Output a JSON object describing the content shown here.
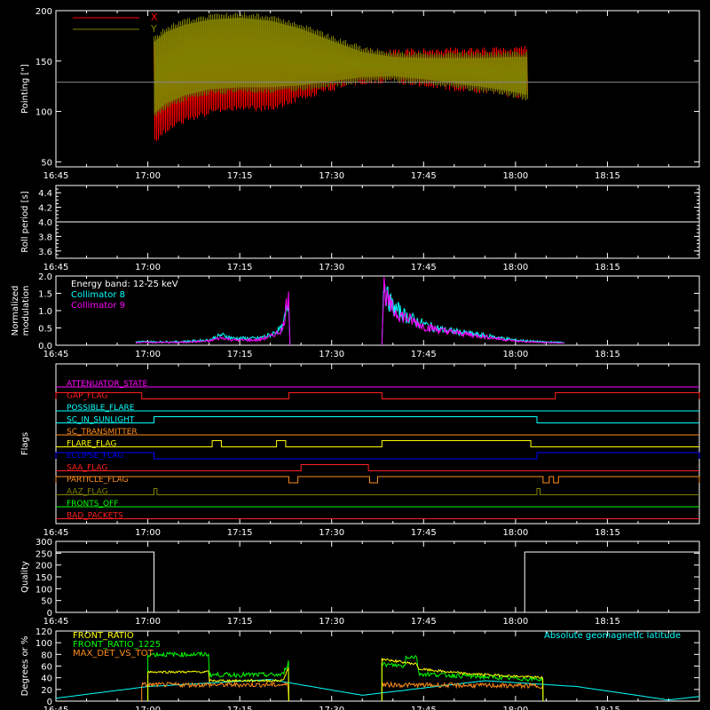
{
  "time_axis": {
    "tmin": "16:45",
    "tmax": "18:30",
    "tick_labels": [
      "16:45",
      "17:00",
      "17:15",
      "17:30",
      "17:45",
      "18:00",
      "18:15"
    ]
  },
  "colors": {
    "axes": "#ffffff",
    "x": "#ff0000",
    "y": "#808000",
    "cyan": "#00ffff",
    "magenta": "#ff00ff",
    "yellow": "#ffff00",
    "green": "#00ff00",
    "orange": "#ff8c1a",
    "red": "#ff2020",
    "blue": "#0000ff"
  },
  "chart_data": [
    {
      "type": "line",
      "id": "pointing",
      "ylabel": "Pointing [\"]",
      "ylim": [
        45,
        200
      ],
      "yticks": [
        "50",
        "100",
        "150",
        "200"
      ],
      "legend": [
        "X",
        "Y"
      ],
      "legend_position": "top-left",
      "reference_line": 129,
      "series": [
        {
          "name": "X",
          "x": [
            "17:01",
            "17:03",
            "17:06",
            "17:10",
            "17:15",
            "17:20",
            "17:25",
            "17:30",
            "17:35",
            "17:40",
            "17:45",
            "17:50",
            "17:55",
            "18:00",
            "18:02"
          ],
          "upper": [
            172,
            180,
            186,
            190,
            190,
            188,
            180,
            170,
            163,
            162,
            163,
            164,
            164,
            165,
            165
          ],
          "lower": [
            68,
            78,
            88,
            96,
            100,
            100,
            110,
            120,
            126,
            127,
            124,
            120,
            117,
            113,
            112
          ]
        },
        {
          "name": "Y",
          "x": [
            "17:01",
            "17:03",
            "17:06",
            "17:10",
            "17:15",
            "17:20",
            "17:25",
            "17:30",
            "17:35",
            "17:40",
            "17:45",
            "17:50",
            "17:55",
            "18:00",
            "18:02"
          ],
          "upper": [
            175,
            185,
            192,
            197,
            199,
            196,
            188,
            176,
            165,
            160,
            159,
            159,
            159,
            160,
            160
          ],
          "lower": [
            92,
            102,
            110,
            116,
            118,
            118,
            120,
            124,
            128,
            129,
            126,
            122,
            118,
            113,
            110
          ]
        }
      ]
    },
    {
      "type": "line",
      "id": "roll-period",
      "ylabel": "Roll period [s]",
      "ylim": [
        3.5,
        4.5
      ],
      "yticks": [
        "3.6",
        "3.8",
        "4.0",
        "4.2",
        "4.4"
      ],
      "series": [
        {
          "x": [
            "16:45",
            "18:30"
          ],
          "y": [
            4.0,
            4.0
          ]
        }
      ]
    },
    {
      "type": "line",
      "id": "modulation",
      "ylabel": "Normalized modulation",
      "ylim": [
        0,
        2.0
      ],
      "yticks": [
        "0.0",
        "0.5",
        "1.0",
        "1.5",
        "2.0"
      ],
      "annotation": "Energy band: 12-25 keV",
      "legend_position": "top-left",
      "series": [
        {
          "name": "Collimator 8",
          "x": [
            "16:58",
            "17:05",
            "17:10",
            "17:12",
            "17:14",
            "17:18",
            "17:20",
            "17:22",
            "17:23",
            "17:23.2",
            "17:38.2",
            "17:38.5",
            "17:39",
            "17:40",
            "17:42",
            "17:45",
            "17:48",
            "17:52",
            "17:56",
            "18:00",
            "18:04",
            "18:08"
          ],
          "y": [
            0.1,
            0.1,
            0.15,
            0.3,
            0.2,
            0.2,
            0.3,
            0.5,
            1.3,
            0.0,
            0.0,
            1.9,
            1.4,
            1.1,
            0.85,
            0.6,
            0.45,
            0.35,
            0.25,
            0.15,
            0.1,
            0.08
          ]
        },
        {
          "name": "Collimator 9",
          "x": [
            "16:58",
            "17:05",
            "17:10",
            "17:12",
            "17:14",
            "17:18",
            "17:20",
            "17:22",
            "17:23",
            "17:23.2",
            "17:38.2",
            "17:38.5",
            "17:39",
            "17:40",
            "17:42",
            "17:45",
            "17:48",
            "17:52",
            "17:56",
            "18:00",
            "18:04",
            "18:08"
          ],
          "y": [
            0.08,
            0.08,
            0.12,
            0.22,
            0.15,
            0.15,
            0.25,
            0.45,
            1.6,
            0.0,
            0.0,
            1.75,
            1.3,
            1.0,
            0.8,
            0.55,
            0.42,
            0.32,
            0.22,
            0.12,
            0.08,
            0.06
          ]
        }
      ]
    },
    {
      "type": "line",
      "id": "flags",
      "ylabel": "Flags",
      "series": [
        {
          "name": "ATTENUATOR_STATE",
          "color": "#ff00ff",
          "segments": []
        },
        {
          "name": "GAP_FLAG",
          "color": "#ff2020",
          "segments": [
            [
              "16:45",
              "16:59"
            ],
            [
              "17:23",
              "17:38.2"
            ],
            [
              "18:06.5",
              "18:30"
            ]
          ]
        },
        {
          "name": "POSSIBLE_FLARE",
          "color": "#00ffff",
          "segments": []
        },
        {
          "name": "SC_IN_SUNLIGHT",
          "color": "#00ffff",
          "segments": [
            [
              "17:01",
              "18:03.5"
            ]
          ]
        },
        {
          "name": "SC_TRANSMITTER",
          "color": "#ff8c1a",
          "segments": []
        },
        {
          "name": "FLARE_FLAG",
          "color": "#ffff00",
          "segments": [
            [
              "17:10.5",
              "17:12"
            ],
            [
              "17:21",
              "17:22.5"
            ],
            [
              "17:38.2",
              "18:02.5"
            ]
          ]
        },
        {
          "name": "ECLIPSE_FLAG",
          "color": "#0000ff",
          "segments": [
            [
              "16:45",
              "17:01"
            ],
            [
              "18:03.5",
              "18:30"
            ]
          ]
        },
        {
          "name": "SAA_FLAG",
          "color": "#ff2020",
          "segments": [
            [
              "17:25",
              "17:36"
            ]
          ]
        },
        {
          "name": "PARTICLE_FLAG",
          "color": "#ff8c1a",
          "segments": [
            [
              "16:45",
              "17:23"
            ],
            [
              "17:24.5",
              "17:36.2"
            ],
            [
              "17:37.5",
              "18:04.5"
            ],
            [
              "18:05.5",
              "18:06.2"
            ],
            [
              "18:07",
              "18:30"
            ]
          ]
        },
        {
          "name": "AAZ_FLAG",
          "color": "#808000",
          "segments": [
            [
              "17:01",
              "17:01.5"
            ],
            [
              "18:03.5",
              "18:04"
            ]
          ]
        },
        {
          "name": "FRONTS_OFF",
          "color": "#00ff00",
          "segments": []
        },
        {
          "name": "BAD_PACKETS",
          "color": "#ff2020",
          "segments": []
        }
      ]
    },
    {
      "type": "line",
      "id": "quality",
      "ylabel": "Quality",
      "ylim": [
        0,
        300
      ],
      "yticks": [
        "0",
        "50",
        "100",
        "150",
        "200",
        "250",
        "300"
      ],
      "series": [
        {
          "x": [
            "16:45",
            "17:01",
            "17:01",
            "18:01.5",
            "18:01.5",
            "18:30"
          ],
          "y": [
            255,
            255,
            0,
            0,
            255,
            255
          ]
        }
      ]
    },
    {
      "type": "line",
      "id": "ratios",
      "ylabel": "Degrees or %",
      "ylim": [
        0,
        120
      ],
      "yticks": [
        "0",
        "20",
        "40",
        "60",
        "80",
        "100",
        "120"
      ],
      "legend_position": "top-left",
      "annotation": "Absolute geomagnetic latitude",
      "series": [
        {
          "name": "FRONT_RATIO",
          "x": [
            "17:00",
            "17:00",
            "17:10",
            "17:10",
            "17:23",
            "17:23"
          ],
          "y": [
            0,
            50,
            50,
            35,
            35,
            0
          ]
        },
        {
          "name": "FRONT_RATIO_1225",
          "x": [
            "17:00",
            "17:00",
            "17:10",
            "17:10",
            "17:22",
            "17:23",
            "17:23"
          ],
          "y": [
            0,
            80,
            80,
            45,
            45,
            70,
            0
          ]
        },
        {
          "name": "MAX_DET_VS_TOT",
          "x": [
            "16:59",
            "16:59",
            "17:23",
            "17:23"
          ],
          "y": [
            0,
            30,
            30,
            0
          ]
        },
        {
          "name": "Absolute geomagnetic latitude",
          "x": [
            "16:45",
            "17:00",
            "17:20",
            "17:35",
            "17:55",
            "18:10",
            "18:25",
            "18:30"
          ],
          "y": [
            5,
            25,
            37,
            10,
            35,
            25,
            2,
            8
          ]
        }
      ]
    }
  ]
}
